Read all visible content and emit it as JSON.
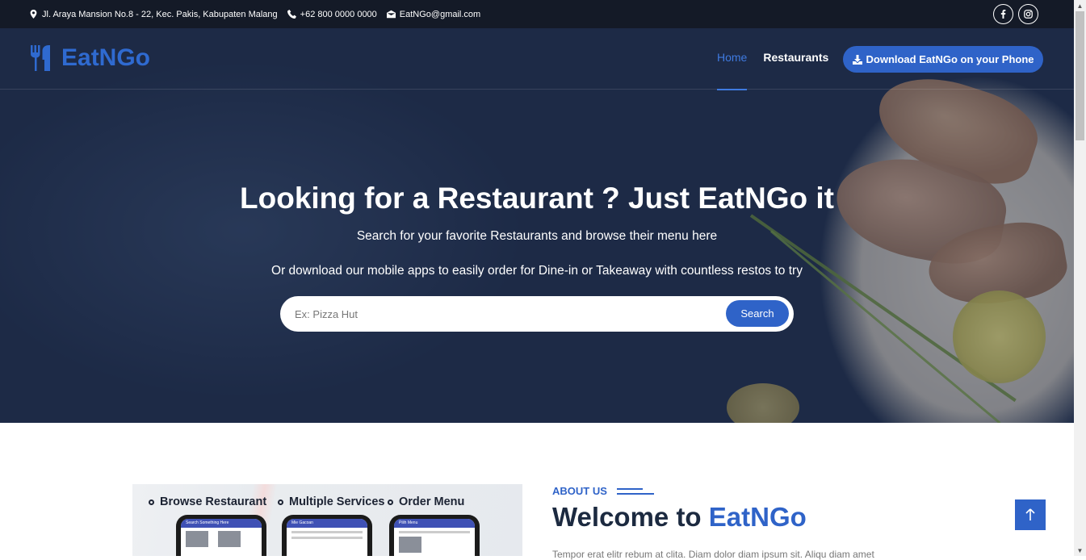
{
  "topbar": {
    "address": "Jl. Araya Mansion No.8 - 22, Kec. Pakis, Kabupaten Malang",
    "phone": "+62 800 0000 0000",
    "email": "EatNGo@gmail.com",
    "socials": [
      "facebook-icon",
      "instagram-icon"
    ]
  },
  "brand": {
    "name": "EatNGo",
    "color": "#2f63c8"
  },
  "nav": {
    "items": [
      {
        "label": "Home",
        "active": true
      },
      {
        "label": "Restaurants",
        "active": false
      }
    ],
    "download_label": "Download EatNGo on your Phone"
  },
  "hero": {
    "title": "Looking for a Restaurant ? Just EatNGo it",
    "subtitle1": "Search for your favorite Restaurants and browse their menu here",
    "subtitle2": "Or download our mobile apps to easily order for Dine-in or Takeaway with countless restos to try",
    "search_placeholder": "Ex: Pizza Hut",
    "search_button": "Search"
  },
  "about": {
    "label": "ABOUT US",
    "title_prefix": "Welcome to ",
    "title_brand": "EatNGo",
    "text": "Tempor erat elitr rebum at clita. Diam dolor diam ipsum sit. Aliqu diam amet",
    "image_features": [
      "Browse Restaurant",
      "Multiple Services",
      "Order Menu"
    ],
    "phone_screens": [
      "Search Something Here",
      "Mie Gacoan",
      "Pilih Menu"
    ]
  }
}
